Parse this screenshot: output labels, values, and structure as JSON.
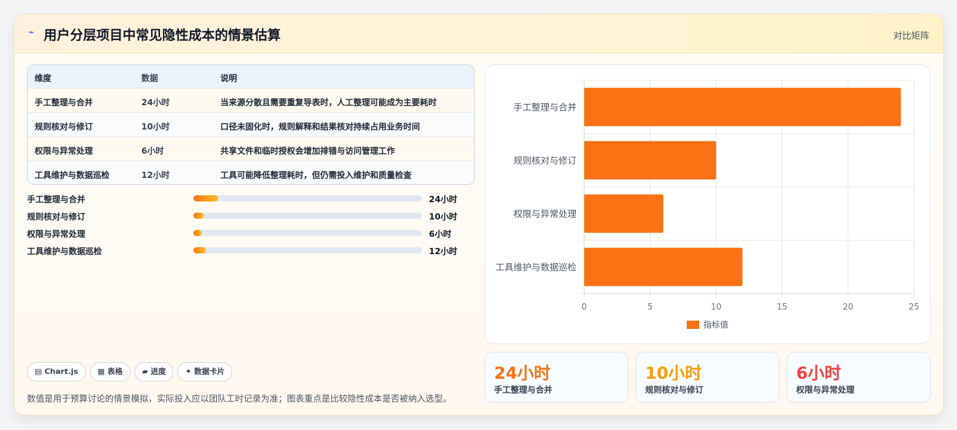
{
  "header": {
    "logo_icon": "⌁",
    "title": "用户分层项目中常见隐性成本的情景估算",
    "right_label": "对比矩阵"
  },
  "table": {
    "columns": [
      "维度",
      "数据",
      "说明"
    ],
    "rows": [
      [
        "手工整理与合并",
        "24小时",
        "当来源分散且需要重复导表时，人工整理可能成为主要耗时"
      ],
      [
        "规则核对与修订",
        "10小时",
        "口径未固化时，规则解释和结果核对持续占用业务时间"
      ],
      [
        "权限与异常处理",
        "6小时",
        "共享文件和临时授权会增加排错与访问管理工作"
      ],
      [
        "工具维护与数据巡检",
        "12小时",
        "工具可能降低整理耗时，但仍需投入维护和质量检查"
      ]
    ]
  },
  "progress": [
    {
      "label": "手工整理与合并",
      "value": "24小时",
      "fraction": 0.11
    },
    {
      "label": "规则核对与修订",
      "value": "10小时",
      "fraction": 0.045
    },
    {
      "label": "权限与异常处理",
      "value": "6小时",
      "fraction": 0.035
    },
    {
      "label": "工具维护与数据巡检",
      "value": "12小时",
      "fraction": 0.055
    }
  ],
  "tags": [
    "▤ Chart.js",
    "▦ 表格",
    "▰ 进度",
    "✦ 数据卡片"
  ],
  "note": "数值是用于预算讨论的情景模拟，实际投入应以团队工时记录为准；图表重点是比较隐性成本是否被纳入选型。",
  "chart_data": {
    "type": "bar",
    "orientation": "horizontal",
    "categories": [
      "手工整理与合并",
      "规则核对与修订",
      "权限与异常处理",
      "工具维护与数据巡检"
    ],
    "series": [
      {
        "name": "指标值",
        "values": [
          24,
          10,
          6,
          12
        ],
        "color": "#f97316"
      }
    ],
    "xlim": [
      0,
      25
    ],
    "xticks": [
      0,
      5,
      10,
      15,
      20,
      25
    ],
    "grid": true,
    "legend": "bottom"
  },
  "kpis": [
    {
      "value": "24小时",
      "label": "手工整理与合并",
      "color": "#f97316"
    },
    {
      "value": "10小时",
      "label": "规则核对与修订",
      "color": "#f59e0b"
    },
    {
      "value": "6小时",
      "label": "权限与异常处理",
      "color": "#ef4444"
    }
  ]
}
